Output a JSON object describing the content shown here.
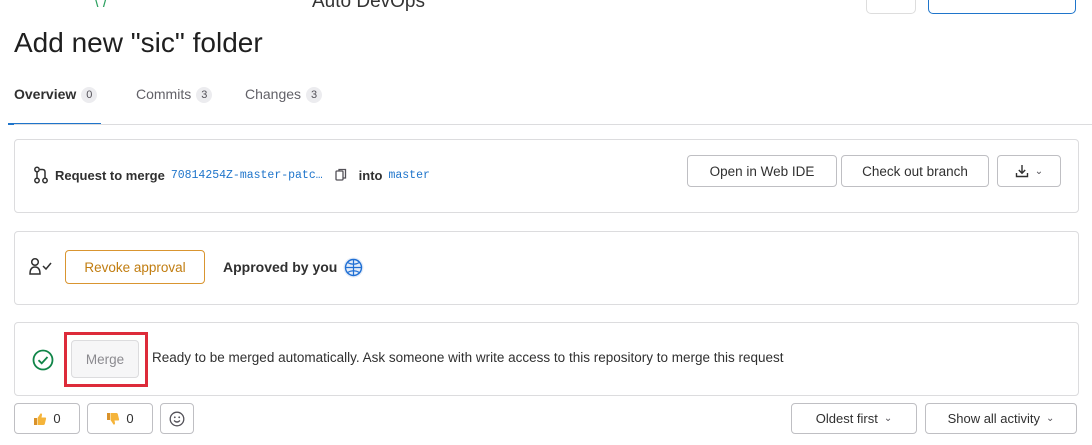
{
  "header": {
    "app_name": "Auto DevOps",
    "title": "Add new \"sic\" folder"
  },
  "tabs": [
    {
      "label": "Overview",
      "count": "0",
      "active": true
    },
    {
      "label": "Commits",
      "count": "3",
      "active": false
    },
    {
      "label": "Changes",
      "count": "3",
      "active": false
    }
  ],
  "merge_request": {
    "request_label": "Request to merge",
    "source_branch": "70814254Z-master-patc…",
    "into_label": "into",
    "target_branch": "master",
    "open_web_ide_label": "Open in Web IDE",
    "checkout_label": "Check out branch",
    "icons": [
      "merge-request-icon",
      "copy-icon",
      "download-icon",
      "chevron-down-icon"
    ]
  },
  "approval": {
    "revoke_label": "Revoke approval",
    "approved_text": "Approved by you",
    "icons": [
      "approval-icon",
      "avatar"
    ]
  },
  "ready": {
    "merge_label": "Merge",
    "message": "Ready to be merged automatically. Ask someone with write access to this repository to merge this request",
    "status_icon": "check-circle-icon",
    "highlight_color": "#dd2b3a"
  },
  "footer": {
    "thumbs_up_count": "0",
    "thumbs_down_count": "0",
    "sort_label": "Oldest first",
    "filter_label": "Show all activity"
  },
  "colors": {
    "accent": "#1f75cb",
    "warning": "#d99530",
    "success": "#108548"
  }
}
